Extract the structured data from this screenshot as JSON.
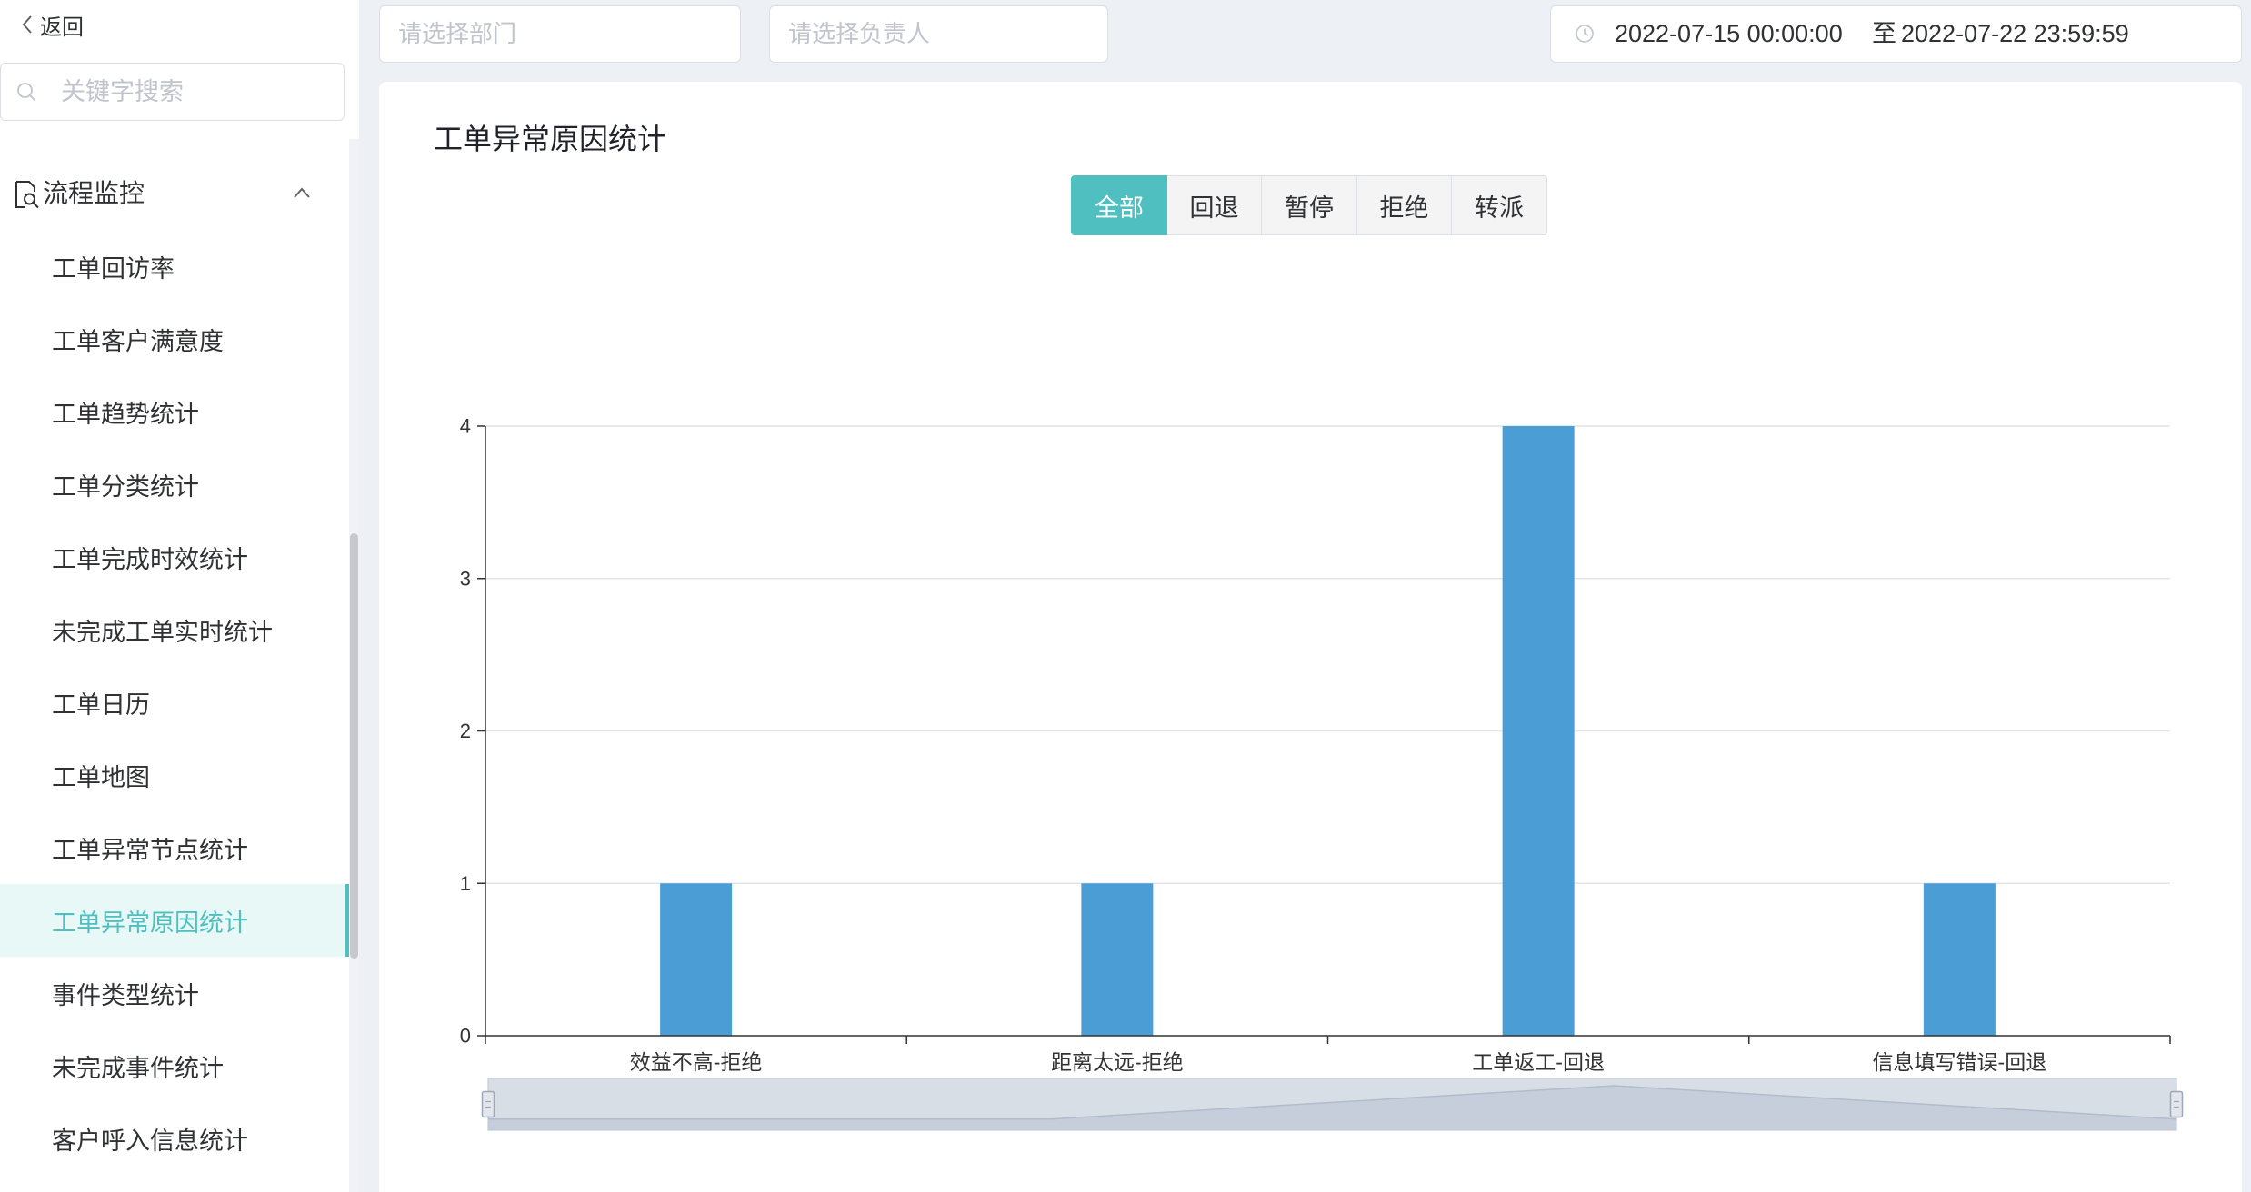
{
  "sidebar": {
    "back_label": "返回",
    "search_placeholder": "关键字搜索",
    "group": {
      "label": "流程监控",
      "icon": "document-search-icon",
      "expanded": true
    },
    "items": [
      {
        "label": "工单回访率"
      },
      {
        "label": "工单客户满意度"
      },
      {
        "label": "工单趋势统计"
      },
      {
        "label": "工单分类统计"
      },
      {
        "label": "工单完成时效统计"
      },
      {
        "label": "未完成工单实时统计"
      },
      {
        "label": "工单日历"
      },
      {
        "label": "工单地图"
      },
      {
        "label": "工单异常节点统计"
      },
      {
        "label": "工单异常原因统计",
        "active": true
      },
      {
        "label": "事件类型统计"
      },
      {
        "label": "未完成事件统计"
      },
      {
        "label": "客户呼入信息统计"
      }
    ]
  },
  "filters": {
    "department_placeholder": "请选择部门",
    "owner_placeholder": "请选择负责人",
    "date_range": {
      "icon": "clock-icon",
      "start": "2022-07-15 00:00:00",
      "separator": "至",
      "end": "2022-07-22 23:59:59"
    }
  },
  "card": {
    "title": "工单异常原因统计",
    "tabs": [
      {
        "label": "全部",
        "active": true
      },
      {
        "label": "回退"
      },
      {
        "label": "暂停"
      },
      {
        "label": "拒绝"
      },
      {
        "label": "转派"
      }
    ]
  },
  "colors": {
    "accent": "#4fbfbf",
    "bar": "#4a9ed5"
  },
  "chart_data": {
    "type": "bar",
    "categories": [
      "效益不高-拒绝",
      "距离太远-拒绝",
      "工单返工-回退",
      "信息填写错误-回退"
    ],
    "values": [
      1,
      1,
      4,
      1
    ],
    "ylim": [
      0,
      4
    ],
    "yticks": [
      0,
      1,
      2,
      3,
      4
    ],
    "grid": true,
    "legend": "none",
    "data_zoom": {
      "start": 0,
      "end": 100
    }
  }
}
